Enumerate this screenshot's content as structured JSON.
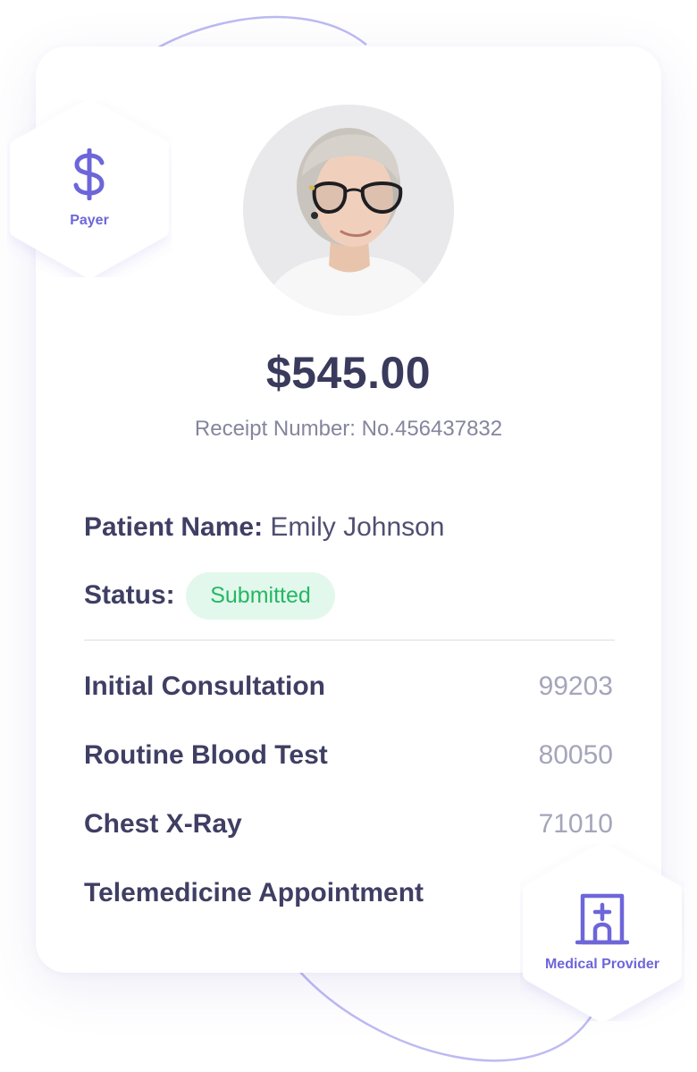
{
  "receipt": {
    "amount": "$545.00",
    "receipt_number_text": "Receipt Number: No.456437832",
    "patient_label": "Patient Name:",
    "patient_name": "Emily Johnson",
    "status_label": "Status:",
    "status_value": "Submitted"
  },
  "services": [
    {
      "name": "Initial Consultation",
      "code": "99203"
    },
    {
      "name": "Routine Blood Test",
      "code": "80050"
    },
    {
      "name": "Chest X-Ray",
      "code": "71010"
    },
    {
      "name": "Telemedicine Appointment",
      "code": ""
    }
  ],
  "badges": {
    "payer": {
      "label": "Payer",
      "icon": "dollar-icon"
    },
    "provider": {
      "label": "Medical Provider",
      "icon": "hospital-icon"
    }
  },
  "colors": {
    "accent": "#6d66d9",
    "status_bg": "#e3f8ec",
    "status_text": "#24b863",
    "text_dark": "#3f3f64"
  }
}
